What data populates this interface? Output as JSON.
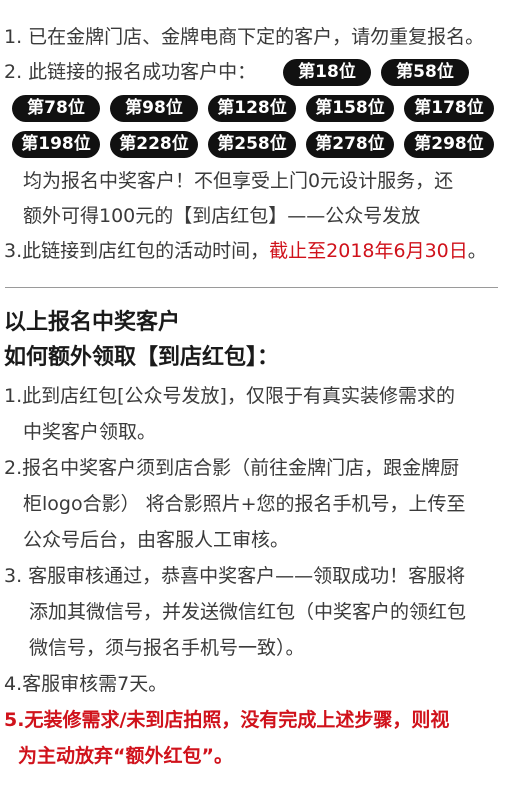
{
  "section1": {
    "item1": "1. 已在金牌门店、金牌电商下定的客户，请勿重复报名。",
    "item2_label": "2. 此链接的报名成功客户中：",
    "pills": [
      "第18位",
      "第58位",
      "第78位",
      "第98位",
      "第128位",
      "第158位",
      "第178位",
      "第198位",
      "第228位",
      "第258位",
      "第278位",
      "第298位"
    ],
    "item2_text1": "均为报名中奖客户！不但享受上门0元设计服务，还",
    "item2_text2": "额外可得100元的【到店红包】——公众号发放",
    "item3_prefix": "3.此链接到店红包的活动时间，",
    "item3_deadline": "截止至2018年6月30日",
    "item3_suffix": "。"
  },
  "section2": {
    "heading1": "以上报名中奖客户",
    "heading2": "如何额外领取【到店红包】：",
    "step1_line1": "1.此到店红包[公众号发放]，仅限于有真实装修需求的",
    "step1_line2": "中奖客户领取。",
    "step2_line1": "2.报名中奖客户须到店合影（前往金牌门店，跟金牌厨",
    "step2_line2": "柜logo合影） 将合影照片+您的报名手机号，上传至",
    "step2_line3": "公众号后台，由客服人工审核。",
    "step3_line1": "3. 客服审核通过，恭喜中奖客户——领取成功！客服将",
    "step3_line2": "添加其微信号，并发送微信红包（中奖客户的领红包",
    "step3_line3": "微信号，须与报名手机号一致）。",
    "step4": "4.客服审核需7天。",
    "step5_line1": "5.无装修需求/未到店拍照，没有完成上述步骤，则视",
    "step5_line2": "为主动放弃“额外红包”。"
  },
  "colors": {
    "highlight": "#d0121b",
    "pill_bg": "#111111",
    "text": "#3a3a3a"
  }
}
